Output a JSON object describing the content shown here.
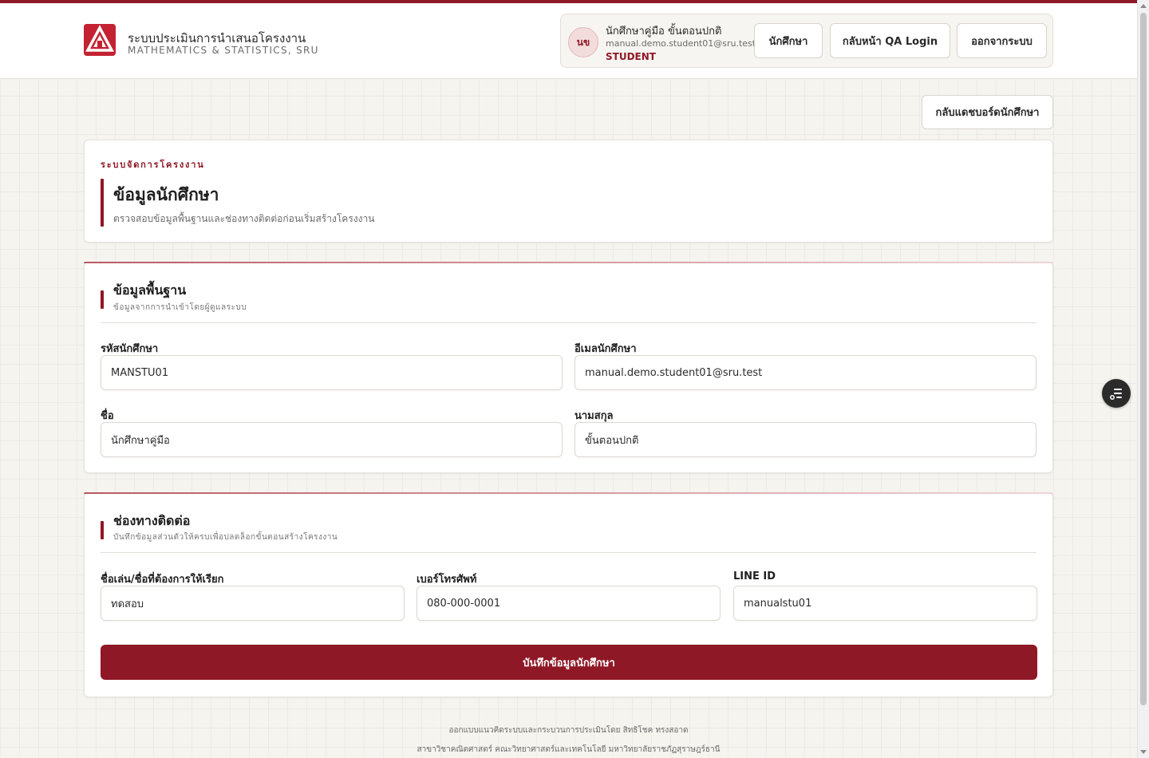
{
  "header": {
    "brand_title": "ระบบประเมินการนำเสนอโครงงาน",
    "brand_subtitle": "MATHEMATICS & STATISTICS, SRU",
    "user": {
      "initials": "นข",
      "name": "นักศึกษาคู่มือ ขั้นตอนปกติ",
      "email": "manual.demo.student01@sru.test",
      "role": "STUDENT"
    },
    "buttons": {
      "student": "นักศึกษา",
      "qa_login": "กลับหน้า QA Login",
      "logout": "ออกจากระบบ"
    }
  },
  "back_button": "กลับแดชบอร์ดนักศึกษา",
  "intro": {
    "kicker": "ระบบจัดการโครงงาน",
    "title": "ข้อมูลนักศึกษา",
    "description": "ตรวจสอบข้อมูลพื้นฐานและช่องทางติดต่อก่อนเริ่มสร้างโครงงาน"
  },
  "basic": {
    "title": "ข้อมูลพื้นฐาน",
    "subtitle": "ข้อมูลจากการนำเข้าโดยผู้ดูแลระบบ",
    "student_id_label": "รหัสนักศึกษา",
    "student_id_value": "MANSTU01",
    "email_label": "อีเมลนักศึกษา",
    "email_value": "manual.demo.student01@sru.test",
    "first_name_label": "ชื่อ",
    "first_name_value": "นักศึกษาคู่มือ",
    "last_name_label": "นามสกุล",
    "last_name_value": "ขั้นตอนปกติ"
  },
  "contact": {
    "title": "ช่องทางติดต่อ",
    "subtitle": "บันทึกข้อมูลส่วนตัวให้ครบเพื่อปลดล็อกขั้นตอนสร้างโครงงาน",
    "nickname_label": "ชื่อเล่น/ชื่อที่ต้องการให้เรียก",
    "nickname_value": "ทดสอบ",
    "phone_label": "เบอร์โทรศัพท์",
    "phone_value": "080-000-0001",
    "line_label": "LINE ID",
    "line_value": "manualstu01",
    "save_button": "บันทึกข้อมูลนักศึกษา"
  },
  "footer": {
    "line1": "ออกแบบแนวคิดระบบและกระบวนการประเมินโดย สิทธิโชค ทรงสอาด",
    "line2": "สาขาวิชาคณิตศาสตร์ คณะวิทยาศาสตร์และเทคโนโลยี มหาวิทยาลัยราชภัฏสุราษฎร์ธานี"
  },
  "colors": {
    "brand": "#8f1826",
    "logo": "#c42232",
    "background": "#f6f4ef"
  },
  "icons": {
    "logo": "sru-logo-icon",
    "floating": "settings-panel-icon"
  }
}
